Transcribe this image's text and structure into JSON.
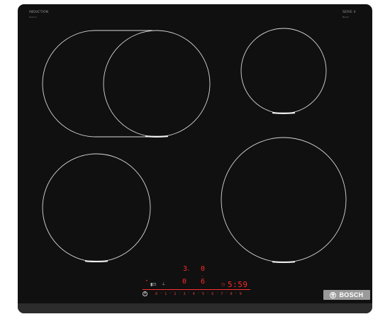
{
  "brand": {
    "product_line": "INDUCTION",
    "product_subline": "Serie 4",
    "series_label": "SERIE 4",
    "series_sub": "Bosch",
    "logo_text": "BOSCH"
  },
  "zones": [
    {
      "id": "front-left-flex",
      "shape": "flex",
      "label": "FlexInduction zone"
    },
    {
      "id": "back-right",
      "shape": "circle",
      "label": "Rear right zone"
    },
    {
      "id": "front-left",
      "shape": "circle",
      "label": "Front left zone"
    },
    {
      "id": "front-right",
      "shape": "circle",
      "label": "Front right zone"
    }
  ],
  "display": {
    "zone_rear_left": "3",
    "zone_rear_left_suffix": "ₛ",
    "zone_rear_right": "0",
    "zone_front_left": "0",
    "zone_front_right": "6",
    "zone_front_right_super": "-",
    "timer": "5:59",
    "indicator_dot": "•"
  },
  "control_scale": [
    "0",
    "1",
    "2",
    "3",
    "4",
    "5",
    "6",
    "7",
    "8",
    "9"
  ],
  "controls": {
    "power_icon": "power-icon",
    "lock_icon": "child-lock-icon",
    "flex_icon": "flex-zone-icon",
    "timer_icon": "timer-icon"
  },
  "colors": {
    "glass": "#101010",
    "frame": "#2c2c2c",
    "zone_outline": "#d8d8d8",
    "led": "#ff2a2a",
    "badge": "#9a9a9a"
  }
}
